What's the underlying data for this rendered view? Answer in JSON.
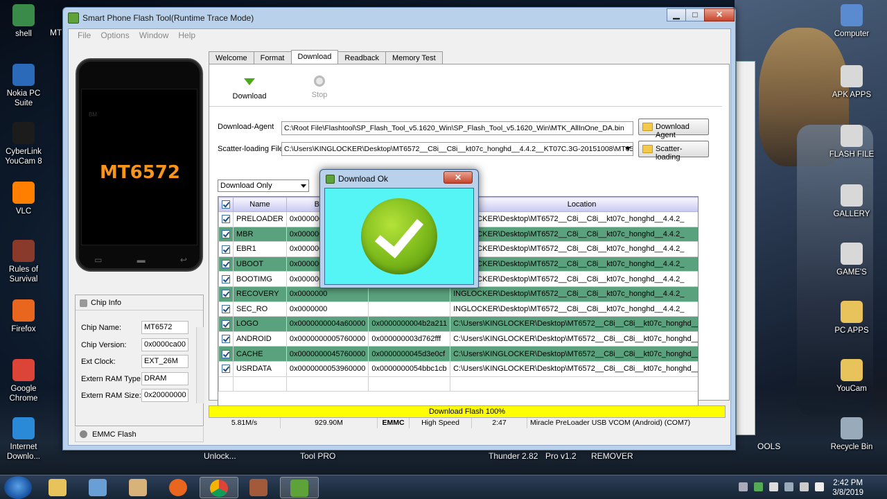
{
  "window": {
    "title": "Smart Phone Flash Tool(Runtime Trace Mode)",
    "menu": [
      "File",
      "Options",
      "Window",
      "Help"
    ],
    "min": "▁",
    "max": "□",
    "close": "✕"
  },
  "phone": {
    "chip": "MT6572",
    "brand": "BM"
  },
  "chip_info": {
    "header": "Chip Info",
    "rows": [
      {
        "k": "Chip Name:",
        "v": "MT6572"
      },
      {
        "k": "Chip Version:",
        "v": "0x0000ca00"
      },
      {
        "k": "Ext Clock:",
        "v": "EXT_26M"
      },
      {
        "k": "Extern RAM Type:",
        "v": "DRAM"
      },
      {
        "k": "Extern RAM Size:",
        "v": "0x20000000"
      }
    ],
    "emmc": "EMMC Flash"
  },
  "tabs": [
    "Welcome",
    "Format",
    "Download",
    "Readback",
    "Memory Test"
  ],
  "toolbar": {
    "download": "Download",
    "stop": "Stop"
  },
  "download_agent": {
    "label": "Download-Agent",
    "value": "C:\\Root File\\Flashtool\\SP_Flash_Tool_v5.1620_Win\\SP_Flash_Tool_v5.1620_Win\\MTK_AllInOne_DA.bin",
    "button": "Download Agent"
  },
  "scatter": {
    "label": "Scatter-loading File",
    "value": "C:\\Users\\KINGLOCKER\\Desktop\\MT6572__C8i__C8i__kt07c_honghd__4.4.2__KT07C.3G-20151008\\MT6572_",
    "button": "Scatter-loading"
  },
  "mode": "Download Only",
  "table": {
    "headers": [
      "Name",
      "Begin A",
      "",
      "Location"
    ],
    "rows": [
      {
        "name": "PRELOADER",
        "begin": "0x0000000",
        "end": "",
        "loc": "INGLOCKER\\Desktop\\MT6572__C8i__C8i__kt07c_honghd__4.4.2_",
        "g": false
      },
      {
        "name": "MBR",
        "begin": "0x0000000",
        "end": "",
        "loc": "INGLOCKER\\Desktop\\MT6572__C8i__C8i__kt07c_honghd__4.4.2_",
        "g": true
      },
      {
        "name": "EBR1",
        "begin": "0x0000000",
        "end": "",
        "loc": "INGLOCKER\\Desktop\\MT6572__C8i__C8i__kt07c_honghd__4.4.2_",
        "g": false
      },
      {
        "name": "UBOOT",
        "begin": "0x0000000",
        "end": "",
        "loc": "INGLOCKER\\Desktop\\MT6572__C8i__C8i__kt07c_honghd__4.4.2_",
        "g": true
      },
      {
        "name": "BOOTIMG",
        "begin": "0x0000000",
        "end": "",
        "loc": "INGLOCKER\\Desktop\\MT6572__C8i__C8i__kt07c_honghd__4.4.2_",
        "g": false
      },
      {
        "name": "RECOVERY",
        "begin": "0x0000000",
        "end": "",
        "loc": "INGLOCKER\\Desktop\\MT6572__C8i__C8i__kt07c_honghd__4.4.2_",
        "g": true
      },
      {
        "name": "SEC_RO",
        "begin": "0x0000000",
        "end": "",
        "loc": "INGLOCKER\\Desktop\\MT6572__C8i__C8i__kt07c_honghd__4.4.2_",
        "g": false
      },
      {
        "name": "LOGO",
        "begin": "0x0000000004a60000",
        "end": "0x0000000004b2a211",
        "loc": "C:\\Users\\KINGLOCKER\\Desktop\\MT6572__C8i__C8i__kt07c_honghd__4.4.2_",
        "g": true
      },
      {
        "name": "ANDROID",
        "begin": "0x0000000005760000",
        "end": "0x000000003d762fff",
        "loc": "C:\\Users\\KINGLOCKER\\Desktop\\MT6572__C8i__C8i__kt07c_honghd__4.4.2_",
        "g": false
      },
      {
        "name": "CACHE",
        "begin": "0x0000000045760000",
        "end": "0x0000000045d3e0cf",
        "loc": "C:\\Users\\KINGLOCKER\\Desktop\\MT6572__C8i__C8i__kt07c_honghd__4.4.2_",
        "g": true
      },
      {
        "name": "USRDATA",
        "begin": "0x0000000053960000",
        "end": "0x0000000054bbc1cb",
        "loc": "C:\\Users\\KINGLOCKER\\Desktop\\MT6572__C8i__C8i__kt07c_honghd__4.4.2_",
        "g": false
      }
    ]
  },
  "progress": {
    "text": "Download Flash 100%",
    "fraction": 1.0,
    "color": "#ffff00"
  },
  "status": [
    "5.81M/s",
    "929.90M",
    "EMMC",
    "High Speed",
    "2:47",
    "Miracle PreLoader USB VCOM (Android) (COM7)"
  ],
  "dialog": {
    "title": "Download Ok",
    "close": "✕",
    "bg": "#55f5f5"
  },
  "desktop_left": [
    "shell",
    "Nokia PC Suite",
    "CyberLink YouCam 8",
    "VLC",
    "Rules of Survival",
    "Firefox",
    "Google Chrome",
    "Internet Downlo..."
  ],
  "desktop_right": [
    "Computer",
    "APK APPS",
    "FLASH FILE",
    "GALLERY",
    "GAME'S",
    "PC APPS",
    "YouCam",
    "Recycle Bin"
  ],
  "desktop_partial": [
    "MT",
    "OOLS"
  ],
  "bottom_labels": [
    "Unlock...",
    "Tool PRO",
    "Thunder 2.82",
    "Pro v1.2",
    "REMOVER"
  ],
  "taskbar": {
    "time": "2:42 PM",
    "date": "3/8/2019"
  }
}
